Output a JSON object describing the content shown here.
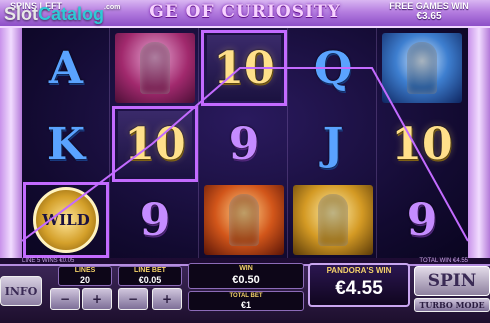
{
  "header": {
    "spins_left_label": "SPINS LEFT",
    "spins_left_value": "",
    "title": "GE OF CURIOSITY",
    "free_games_win_label": "FREE GAMES WIN",
    "free_games_win_value": "€3.65"
  },
  "watermark": {
    "slot": "Slot",
    "catalog": "Catalog",
    "com": ".com"
  },
  "reels": [
    {
      "symbols": [
        "A",
        "pandora",
        "K"
      ],
      "highlight": [
        false,
        false,
        false
      ],
      "wild": [
        false,
        false,
        true
      ]
    },
    {
      "symbols": [
        "pandora",
        "10",
        "9"
      ],
      "highlight": [
        false,
        true,
        false
      ]
    },
    {
      "symbols": [
        "10",
        "9",
        "hades"
      ],
      "highlight": [
        true,
        false,
        false
      ]
    },
    {
      "symbols": [
        "Q",
        "J",
        "hero"
      ],
      "highlight": [
        false,
        false,
        false
      ]
    },
    {
      "symbols": [
        "zeus",
        "10",
        "9"
      ],
      "highlight": [
        false,
        false,
        false
      ]
    }
  ],
  "cells": {
    "c0r0": "A",
    "c0r1": "K",
    "c0r2": "WILD",
    "c1r1": "10",
    "c1r2": "9",
    "c2r0": "10",
    "c2r1": "9",
    "c3r0": "Q",
    "c3r1": "J",
    "c4r1": "10",
    "c4r2": "9"
  },
  "info_row": {
    "left": "LINE 5 WINS €0.05",
    "right": "TOTAL WIN €4.55"
  },
  "controls": {
    "info_label": "INFO",
    "lines_label": "LINES",
    "lines_value": "20",
    "line_bet_label": "LINE BET",
    "line_bet_value": "€0.05",
    "win_label": "WIN",
    "win_value": "€0.50",
    "total_bet_label": "TOTAL BET",
    "total_bet_value": "€1",
    "pandora_win_label": "PANDORA'S WIN",
    "pandora_win_value": "€4.55",
    "spin_label": "SPIN",
    "turbo_label": "TURBO MODE",
    "minus": "−",
    "plus": "+"
  },
  "colors": {
    "accent_purple": "#c36bff",
    "gold": "#f5d36a",
    "panel": "#1d0f2d"
  }
}
